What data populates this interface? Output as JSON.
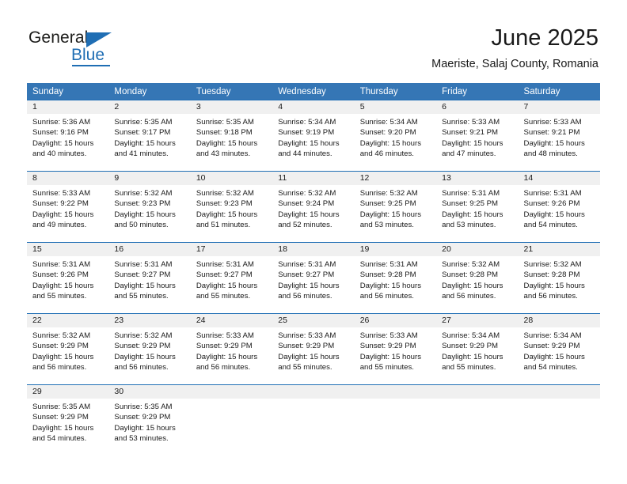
{
  "logo": {
    "word1": "General",
    "word2": "Blue",
    "triangle_icon": "triangle-icon",
    "accent_color": "#1f6eb4"
  },
  "header": {
    "month_title": "June 2025",
    "location": "Maeriste, Salaj County, Romania"
  },
  "theme": {
    "header_blue": "#3576b5",
    "row_line_blue": "#1f6eb4",
    "daynum_band_gray": "#f0f0f0",
    "text": "#1a1a1a"
  },
  "weekday_headers": [
    "Sunday",
    "Monday",
    "Tuesday",
    "Wednesday",
    "Thursday",
    "Friday",
    "Saturday"
  ],
  "weeks": [
    [
      {
        "day": "1",
        "sunrise": "Sunrise: 5:36 AM",
        "sunset": "Sunset: 9:16 PM",
        "daylight1": "Daylight: 15 hours",
        "daylight2": "and 40 minutes."
      },
      {
        "day": "2",
        "sunrise": "Sunrise: 5:35 AM",
        "sunset": "Sunset: 9:17 PM",
        "daylight1": "Daylight: 15 hours",
        "daylight2": "and 41 minutes."
      },
      {
        "day": "3",
        "sunrise": "Sunrise: 5:35 AM",
        "sunset": "Sunset: 9:18 PM",
        "daylight1": "Daylight: 15 hours",
        "daylight2": "and 43 minutes."
      },
      {
        "day": "4",
        "sunrise": "Sunrise: 5:34 AM",
        "sunset": "Sunset: 9:19 PM",
        "daylight1": "Daylight: 15 hours",
        "daylight2": "and 44 minutes."
      },
      {
        "day": "5",
        "sunrise": "Sunrise: 5:34 AM",
        "sunset": "Sunset: 9:20 PM",
        "daylight1": "Daylight: 15 hours",
        "daylight2": "and 46 minutes."
      },
      {
        "day": "6",
        "sunrise": "Sunrise: 5:33 AM",
        "sunset": "Sunset: 9:21 PM",
        "daylight1": "Daylight: 15 hours",
        "daylight2": "and 47 minutes."
      },
      {
        "day": "7",
        "sunrise": "Sunrise: 5:33 AM",
        "sunset": "Sunset: 9:21 PM",
        "daylight1": "Daylight: 15 hours",
        "daylight2": "and 48 minutes."
      }
    ],
    [
      {
        "day": "8",
        "sunrise": "Sunrise: 5:33 AM",
        "sunset": "Sunset: 9:22 PM",
        "daylight1": "Daylight: 15 hours",
        "daylight2": "and 49 minutes."
      },
      {
        "day": "9",
        "sunrise": "Sunrise: 5:32 AM",
        "sunset": "Sunset: 9:23 PM",
        "daylight1": "Daylight: 15 hours",
        "daylight2": "and 50 minutes."
      },
      {
        "day": "10",
        "sunrise": "Sunrise: 5:32 AM",
        "sunset": "Sunset: 9:23 PM",
        "daylight1": "Daylight: 15 hours",
        "daylight2": "and 51 minutes."
      },
      {
        "day": "11",
        "sunrise": "Sunrise: 5:32 AM",
        "sunset": "Sunset: 9:24 PM",
        "daylight1": "Daylight: 15 hours",
        "daylight2": "and 52 minutes."
      },
      {
        "day": "12",
        "sunrise": "Sunrise: 5:32 AM",
        "sunset": "Sunset: 9:25 PM",
        "daylight1": "Daylight: 15 hours",
        "daylight2": "and 53 minutes."
      },
      {
        "day": "13",
        "sunrise": "Sunrise: 5:31 AM",
        "sunset": "Sunset: 9:25 PM",
        "daylight1": "Daylight: 15 hours",
        "daylight2": "and 53 minutes."
      },
      {
        "day": "14",
        "sunrise": "Sunrise: 5:31 AM",
        "sunset": "Sunset: 9:26 PM",
        "daylight1": "Daylight: 15 hours",
        "daylight2": "and 54 minutes."
      }
    ],
    [
      {
        "day": "15",
        "sunrise": "Sunrise: 5:31 AM",
        "sunset": "Sunset: 9:26 PM",
        "daylight1": "Daylight: 15 hours",
        "daylight2": "and 55 minutes."
      },
      {
        "day": "16",
        "sunrise": "Sunrise: 5:31 AM",
        "sunset": "Sunset: 9:27 PM",
        "daylight1": "Daylight: 15 hours",
        "daylight2": "and 55 minutes."
      },
      {
        "day": "17",
        "sunrise": "Sunrise: 5:31 AM",
        "sunset": "Sunset: 9:27 PM",
        "daylight1": "Daylight: 15 hours",
        "daylight2": "and 55 minutes."
      },
      {
        "day": "18",
        "sunrise": "Sunrise: 5:31 AM",
        "sunset": "Sunset: 9:27 PM",
        "daylight1": "Daylight: 15 hours",
        "daylight2": "and 56 minutes."
      },
      {
        "day": "19",
        "sunrise": "Sunrise: 5:31 AM",
        "sunset": "Sunset: 9:28 PM",
        "daylight1": "Daylight: 15 hours",
        "daylight2": "and 56 minutes."
      },
      {
        "day": "20",
        "sunrise": "Sunrise: 5:32 AM",
        "sunset": "Sunset: 9:28 PM",
        "daylight1": "Daylight: 15 hours",
        "daylight2": "and 56 minutes."
      },
      {
        "day": "21",
        "sunrise": "Sunrise: 5:32 AM",
        "sunset": "Sunset: 9:28 PM",
        "daylight1": "Daylight: 15 hours",
        "daylight2": "and 56 minutes."
      }
    ],
    [
      {
        "day": "22",
        "sunrise": "Sunrise: 5:32 AM",
        "sunset": "Sunset: 9:29 PM",
        "daylight1": "Daylight: 15 hours",
        "daylight2": "and 56 minutes."
      },
      {
        "day": "23",
        "sunrise": "Sunrise: 5:32 AM",
        "sunset": "Sunset: 9:29 PM",
        "daylight1": "Daylight: 15 hours",
        "daylight2": "and 56 minutes."
      },
      {
        "day": "24",
        "sunrise": "Sunrise: 5:33 AM",
        "sunset": "Sunset: 9:29 PM",
        "daylight1": "Daylight: 15 hours",
        "daylight2": "and 56 minutes."
      },
      {
        "day": "25",
        "sunrise": "Sunrise: 5:33 AM",
        "sunset": "Sunset: 9:29 PM",
        "daylight1": "Daylight: 15 hours",
        "daylight2": "and 55 minutes."
      },
      {
        "day": "26",
        "sunrise": "Sunrise: 5:33 AM",
        "sunset": "Sunset: 9:29 PM",
        "daylight1": "Daylight: 15 hours",
        "daylight2": "and 55 minutes."
      },
      {
        "day": "27",
        "sunrise": "Sunrise: 5:34 AM",
        "sunset": "Sunset: 9:29 PM",
        "daylight1": "Daylight: 15 hours",
        "daylight2": "and 55 minutes."
      },
      {
        "day": "28",
        "sunrise": "Sunrise: 5:34 AM",
        "sunset": "Sunset: 9:29 PM",
        "daylight1": "Daylight: 15 hours",
        "daylight2": "and 54 minutes."
      }
    ],
    [
      {
        "day": "29",
        "sunrise": "Sunrise: 5:35 AM",
        "sunset": "Sunset: 9:29 PM",
        "daylight1": "Daylight: 15 hours",
        "daylight2": "and 54 minutes."
      },
      {
        "day": "30",
        "sunrise": "Sunrise: 5:35 AM",
        "sunset": "Sunset: 9:29 PM",
        "daylight1": "Daylight: 15 hours",
        "daylight2": "and 53 minutes."
      },
      {
        "day": "",
        "sunrise": "",
        "sunset": "",
        "daylight1": "",
        "daylight2": ""
      },
      {
        "day": "",
        "sunrise": "",
        "sunset": "",
        "daylight1": "",
        "daylight2": ""
      },
      {
        "day": "",
        "sunrise": "",
        "sunset": "",
        "daylight1": "",
        "daylight2": ""
      },
      {
        "day": "",
        "sunrise": "",
        "sunset": "",
        "daylight1": "",
        "daylight2": ""
      },
      {
        "day": "",
        "sunrise": "",
        "sunset": "",
        "daylight1": "",
        "daylight2": ""
      }
    ]
  ]
}
